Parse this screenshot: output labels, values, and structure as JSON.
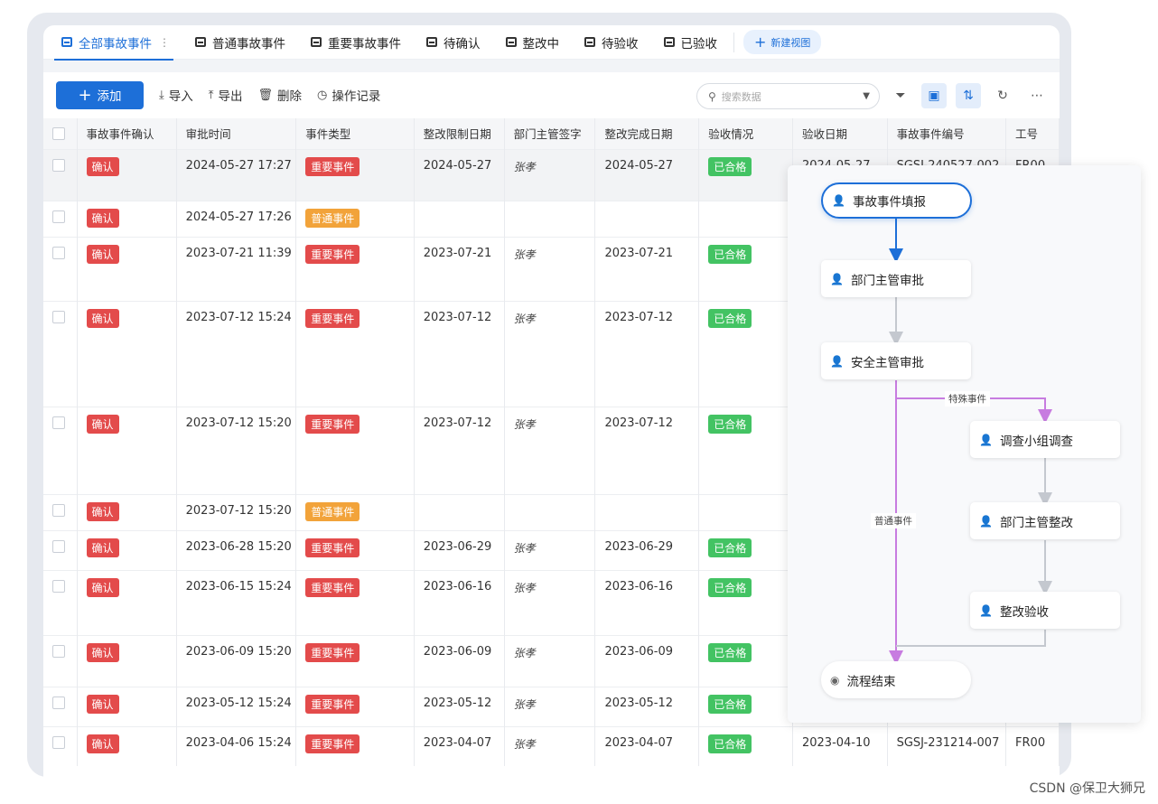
{
  "tabs": [
    {
      "label": "全部事故事件",
      "active": true
    },
    {
      "label": "普通事故事件"
    },
    {
      "label": "重要事故事件"
    },
    {
      "label": "待确认"
    },
    {
      "label": "整改中"
    },
    {
      "label": "待验收"
    },
    {
      "label": "已验收"
    }
  ],
  "tab_more": "⋮",
  "new_view": "新建视图",
  "toolbar": {
    "add": "添加",
    "import": "导入",
    "export": "导出",
    "delete": "删除",
    "history": "操作记录"
  },
  "search": {
    "placeholder": "搜索数据"
  },
  "icons": {
    "filter": "filter-icon",
    "view": "card-view-icon",
    "sort": "sort-icon",
    "refresh": "refresh-icon",
    "more": "more-icon"
  },
  "columns": [
    "事故事件确认",
    "审批时间",
    "事件类型",
    "整改限制日期",
    "部门主管签字",
    "整改完成日期",
    "验收情况",
    "验收日期",
    "事故事件编号",
    "工号"
  ],
  "rows": [
    {
      "confirm": "确认",
      "time": "2024-05-27 17:27",
      "type": "重要事件",
      "limit": "2024-05-27",
      "sign": "张孝",
      "done": "2024-05-27",
      "check": "已合格",
      "check_date": "2024-05-27",
      "code": "SGSJ-240527-002",
      "emp": "FR00"
    },
    {
      "confirm": "确认",
      "time": "2024-05-27 17:26",
      "type": "普通事件",
      "limit": "",
      "sign": "",
      "done": "",
      "check": "",
      "check_date": "",
      "code": "",
      "emp": ""
    },
    {
      "confirm": "确认",
      "time": "2023-07-21 11:39",
      "type": "重要事件",
      "limit": "2023-07-21",
      "sign": "张孝",
      "done": "2023-07-21",
      "check": "已合格",
      "check_date": "",
      "code": "",
      "emp": ""
    },
    {
      "confirm": "确认",
      "time": "2023-07-12 15:24",
      "type": "重要事件",
      "limit": "2023-07-12",
      "sign": "张孝",
      "done": "2023-07-12",
      "check": "已合格",
      "check_date": "",
      "code": "",
      "emp": ""
    },
    {
      "confirm": "确认",
      "time": "2023-07-12 15:20",
      "type": "重要事件",
      "limit": "2023-07-12",
      "sign": "张孝",
      "done": "2023-07-12",
      "check": "已合格",
      "check_date": "",
      "code": "",
      "emp": ""
    },
    {
      "confirm": "确认",
      "time": "2023-07-12 15:20",
      "type": "普通事件",
      "limit": "",
      "sign": "",
      "done": "",
      "check": "",
      "check_date": "",
      "code": "",
      "emp": ""
    },
    {
      "confirm": "确认",
      "time": "2023-06-28 15:20",
      "type": "重要事件",
      "limit": "2023-06-29",
      "sign": "张孝",
      "done": "2023-06-29",
      "check": "已合格",
      "check_date": "",
      "code": "",
      "emp": ""
    },
    {
      "confirm": "确认",
      "time": "2023-06-15 15:24",
      "type": "重要事件",
      "limit": "2023-06-16",
      "sign": "张孝",
      "done": "2023-06-16",
      "check": "已合格",
      "check_date": "",
      "code": "",
      "emp": ""
    },
    {
      "confirm": "确认",
      "time": "2023-06-09 15:20",
      "type": "重要事件",
      "limit": "2023-06-09",
      "sign": "张孝",
      "done": "2023-06-09",
      "check": "已合格",
      "check_date": "",
      "code": "",
      "emp": ""
    },
    {
      "confirm": "确认",
      "time": "2023-05-12 15:24",
      "type": "重要事件",
      "limit": "2023-05-12",
      "sign": "张孝",
      "done": "2023-05-12",
      "check": "已合格",
      "check_date": "",
      "code": "",
      "emp": ""
    },
    {
      "confirm": "确认",
      "time": "2023-04-06 15:24",
      "type": "重要事件",
      "limit": "2023-04-07",
      "sign": "张孝",
      "done": "2023-04-07",
      "check": "已合格",
      "check_date": "2023-04-10",
      "code": "SGSJ-231214-007",
      "emp": "FR00"
    }
  ],
  "flow": {
    "start": "事故事件填报",
    "dept_approve": "部门主管审批",
    "safety_approve": "安全主管审批",
    "investigate": "调查小组调查",
    "rectify": "部门主管整改",
    "accept": "整改验收",
    "end": "流程结束",
    "edge_special": "特殊事件",
    "edge_normal": "普通事件"
  },
  "colors": {
    "primary": "#1d6fd8",
    "important": "#e34b4b",
    "normal": "#f2a33a",
    "passed": "#43c363",
    "branch": "#c77ce0"
  },
  "watermark": "CSDN @保卫大狮兄"
}
